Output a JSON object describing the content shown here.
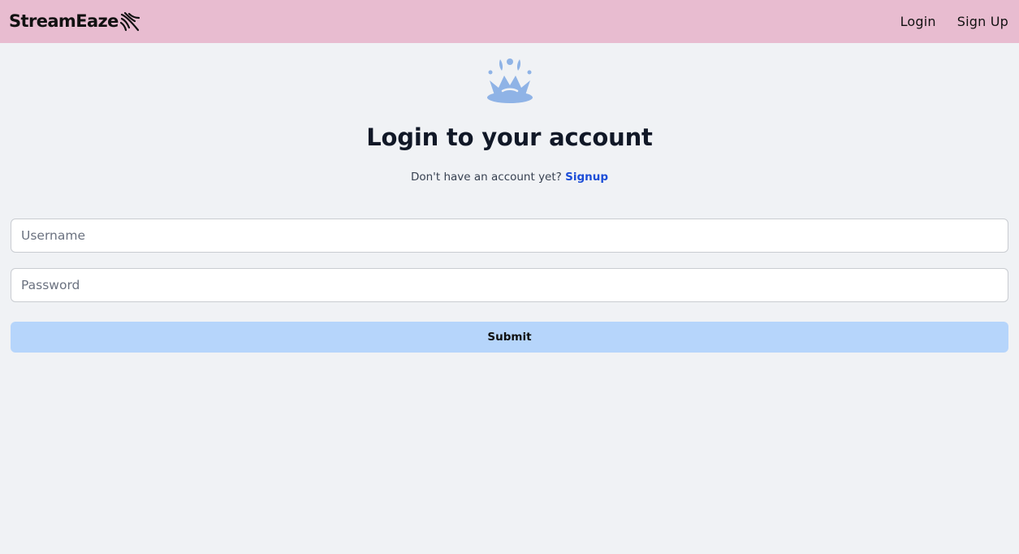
{
  "app": {
    "brand_name": "StreamEaze",
    "brand_icon": "feather-stripes-icon",
    "nav_bg_color": "#e8bcd0",
    "page_bg_color": "#f0f2f5",
    "accent_color": "#b6d5fb",
    "link_color": "#1d4ed8"
  },
  "nav": {
    "login_label": "Login",
    "signup_label": "Sign Up"
  },
  "main": {
    "hero_icon": "splash-crown-icon",
    "title": "Login to your account",
    "subtitle_prefix": "Don't have an account yet?",
    "subtitle_link": "Signup"
  },
  "form": {
    "username_placeholder": "Username",
    "username_value": "",
    "password_placeholder": "Password",
    "password_value": "",
    "submit_label": "Submit"
  }
}
